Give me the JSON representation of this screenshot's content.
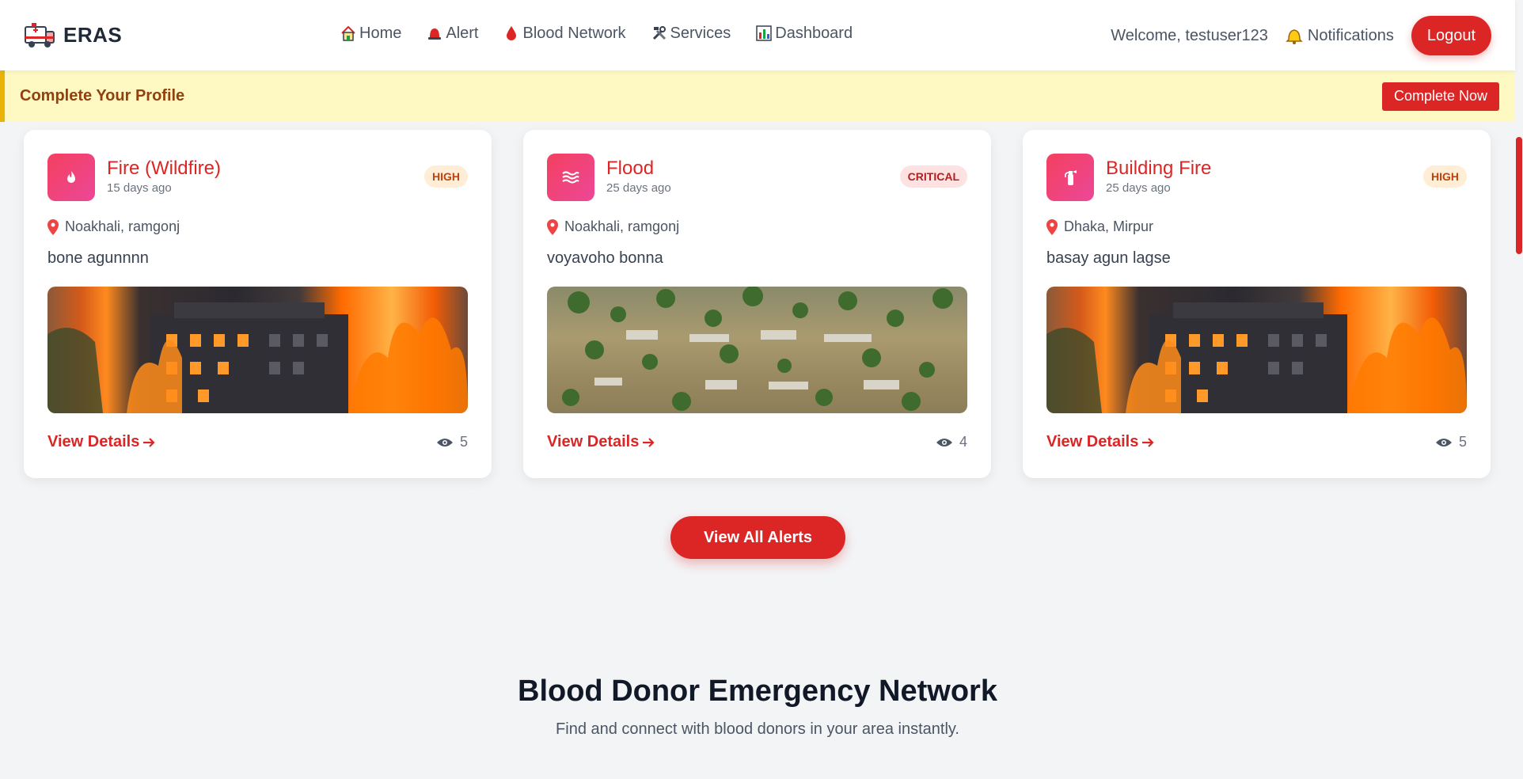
{
  "nav": {
    "brand": "ERAS",
    "links": [
      {
        "label": "Home",
        "icon": "house-icon"
      },
      {
        "label": "Alert",
        "icon": "siren-icon"
      },
      {
        "label": "Blood Network",
        "icon": "blood-drop-icon"
      },
      {
        "label": "Services",
        "icon": "tools-icon"
      },
      {
        "label": "Dashboard",
        "icon": "bar-chart-icon"
      }
    ],
    "welcome": "Welcome, testuser123",
    "notifications": "Notifications",
    "logout": "Logout"
  },
  "profile_banner": {
    "text": "Complete Your Profile",
    "button": "Complete Now"
  },
  "alerts": [
    {
      "title": "Fire (Wildfire)",
      "time": "15 days ago",
      "severity": "HIGH",
      "location": "Noakhali, ramgonj",
      "description": "bone agunnnn",
      "views": "5",
      "icon": "fire-icon",
      "image": "building-fire-photo"
    },
    {
      "title": "Flood",
      "time": "25 days ago",
      "severity": "CRITICAL",
      "location": "Noakhali, ramgonj",
      "description": "voyavoho bonna",
      "views": "4",
      "icon": "water-waves-icon",
      "image": "flood-aerial-photo"
    },
    {
      "title": "Building Fire",
      "time": "25 days ago",
      "severity": "HIGH",
      "location": "Dhaka, Mirpur",
      "description": "basay agun lagse",
      "views": "5",
      "icon": "fire-extinguisher-icon",
      "image": "building-fire-photo"
    }
  ],
  "view_details_label": "View Details",
  "view_all_alerts": "View All Alerts",
  "blood_section": {
    "title": "Blood Donor Emergency Network",
    "subtitle": "Find and connect with blood donors in your area instantly."
  },
  "colors": {
    "primary": "#dc2626",
    "banner_bg": "#fef9c3",
    "banner_border": "#eab308"
  }
}
